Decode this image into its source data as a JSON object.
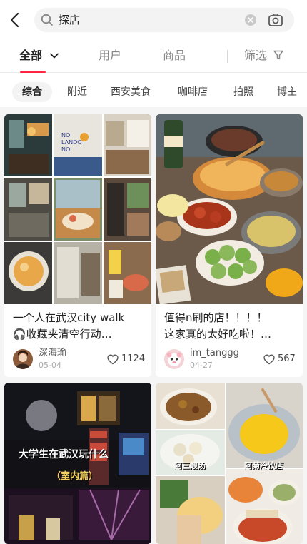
{
  "search": {
    "query": "探店"
  },
  "tabs": [
    {
      "label": "全部",
      "active": true
    },
    {
      "label": "用户"
    },
    {
      "label": "商品"
    },
    {
      "label": "筛选"
    }
  ],
  "chips": [
    "综合",
    "附近",
    "西安美食",
    "咖啡店",
    "拍照",
    "博主"
  ],
  "posts": [
    {
      "title_line1": "一个人在武汉city walk",
      "title_line2": "🎧收藏夹清空行动…",
      "author": "深海瑜",
      "date": "05-04",
      "likes": "1124"
    },
    {
      "title_line1": "值得n刷的店！！！！",
      "title_line2": "这家真的太好吃啦！…",
      "author": "im_tanggg",
      "date": "04-27",
      "likes": "567"
    },
    {
      "overlay_line1": "大学生在武汉玩什么",
      "overlay_line2": "（室内篇）"
    },
    {
      "overlay_line1": "阿三靓汤",
      "overlay_line2": "阿菊冷饮店"
    }
  ],
  "colors": {
    "accent": "#ff2442",
    "chip_bg": "#f3f3f3",
    "search_bg": "#f3f3f3"
  }
}
